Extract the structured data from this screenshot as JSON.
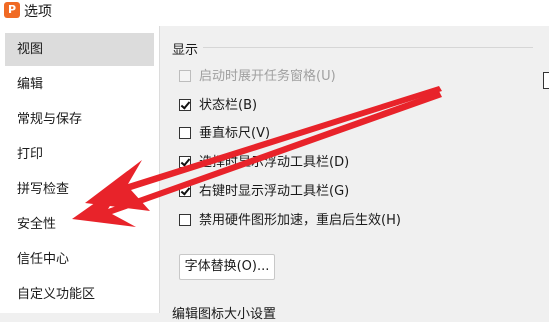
{
  "window": {
    "app_icon_glyph": "P",
    "title": "选项"
  },
  "sidebar": {
    "items": [
      {
        "label": "视图",
        "selected": true
      },
      {
        "label": "编辑",
        "selected": false
      },
      {
        "label": "常规与保存",
        "selected": false
      },
      {
        "label": "打印",
        "selected": false
      },
      {
        "label": "拼写检查",
        "selected": false
      },
      {
        "label": "安全性",
        "selected": false
      },
      {
        "label": "信任中心",
        "selected": false
      },
      {
        "label": "自定义功能区",
        "selected": false
      }
    ]
  },
  "display_section": {
    "title": "显示",
    "options": [
      {
        "label": "启动时展开任务窗格(U)",
        "checked": false,
        "disabled": true
      },
      {
        "label": "状态栏(B)",
        "checked": true,
        "disabled": false
      },
      {
        "label": "垂直标尺(V)",
        "checked": false,
        "disabled": false
      },
      {
        "label": "选择时显示浮动工具栏(D)",
        "checked": true,
        "disabled": false
      },
      {
        "label": "右键时显示浮动工具栏(G)",
        "checked": true,
        "disabled": false
      },
      {
        "label": "禁用硬件图形加速，重启后生效(H)",
        "checked": false,
        "disabled": false
      }
    ],
    "font_replace_button": "字体替换(O)...",
    "next_section_cut_text": "编辑图标大小设置"
  },
  "annotation": {
    "arrow_color": "#e8232a",
    "arrow_icon": "red-arrow-icon"
  }
}
